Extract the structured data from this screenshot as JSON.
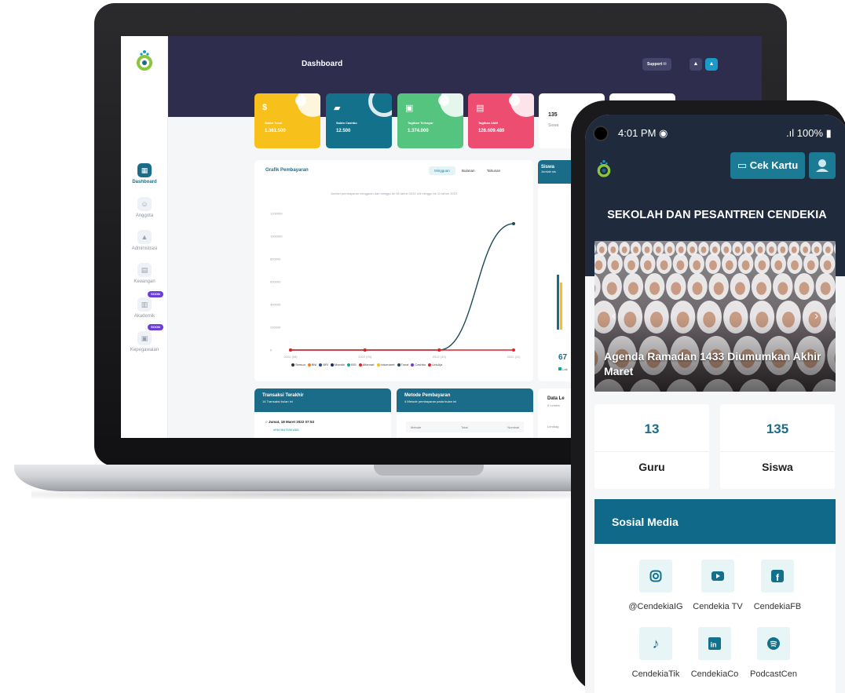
{
  "laptop": {
    "header_title": "Dashboard",
    "support_label": "Support",
    "sidebar": [
      {
        "label": "Dashboard"
      },
      {
        "label": "Anggota"
      },
      {
        "label": "Administrasi"
      },
      {
        "label": "Keuangan"
      },
      {
        "label": "Akademik"
      },
      {
        "label": "Kepegawaian"
      }
    ],
    "soon_label": "SOON",
    "stats": [
      {
        "label": "Saldo Tunai",
        "value": "1.361.500",
        "color": "#f7c01a",
        "icon": "$"
      },
      {
        "label": "Saldo Cashbo",
        "value": "12.500",
        "color": "#14718c",
        "icon": "wallet"
      },
      {
        "label": "Tagihan Terbayar",
        "value": "1.374.000",
        "color": "#55c47e",
        "icon": "folder"
      },
      {
        "label": "Tagihan Aktif",
        "value": "126.609.489",
        "color": "#ee4d72",
        "icon": "doc"
      }
    ],
    "stat_white": {
      "value": "135",
      "label": "Siswa"
    },
    "chart_card": {
      "title": "Grafik Pembayaran",
      "tabs": [
        "Mingguan",
        "Bulanan",
        "Tahunan"
      ],
      "subtitle": "Jumlah pembayaran mingguan dari minggu ke 08 tahun 2022 s/d minggu ke 11 tahun 2022"
    },
    "chart_data": {
      "type": "line",
      "categories": [
        "2022 (08)",
        "2022 (09)",
        "2022 (10)",
        "2022 (11)"
      ],
      "yticks": [
        "0",
        "200000",
        "400000",
        "600000",
        "800000",
        "1000000",
        "1200000"
      ],
      "ylim": [
        0,
        1200000
      ],
      "series": [
        {
          "name": "Tunai",
          "color": "#1c4a56",
          "values": [
            0,
            0,
            0,
            1110000
          ]
        },
        {
          "name": "Alfamart",
          "color": "#e0242a",
          "values": [
            0,
            0,
            0,
            0
          ]
        }
      ],
      "legend": [
        "Semua",
        "BNI",
        "BRI",
        "Mandiri",
        "BSI",
        "Alfamart",
        "Indomaret",
        "Tunai",
        "Cashbo",
        "LinkAja"
      ],
      "legend_colors": [
        "#333333",
        "#f57d20",
        "#274690",
        "#1b2b5a",
        "#14a39a",
        "#e0242a",
        "#f2c418",
        "#1c4a56",
        "#6b3fd6",
        "#e0242a"
      ]
    },
    "side_card": {
      "title": "Siswa",
      "subtitle": "Jumlah sis",
      "value": "67",
      "legend": "Lak"
    },
    "transaksi": {
      "title": "Transaksi Terakhir",
      "subtitle": "14 Transaksi bulan ini",
      "item_date": "Jumat, 18 Maret 2022 07:53",
      "item_code": "#PAYI6475901881"
    },
    "metode": {
      "title": "Metode Pembayaran",
      "subtitle": "4 Metode pembayaran pada bulan ini",
      "cols": [
        "Metode",
        "Total",
        "Nominal"
      ]
    },
    "data_lembaga": {
      "title": "Data Le",
      "subtitle": "0 Lemba",
      "col": "Lembag"
    }
  },
  "phone": {
    "time": "4:01 PM",
    "battery": "100%",
    "signal": ".ıl",
    "cek_kartu": "Cek Kartu",
    "school_name": "SEKOLAH DAN PESANTREN CENDEKIA",
    "news_caption": "Agenda Ramadan 1433 Diumumkan Akhir Maret",
    "stats": [
      {
        "value": "13",
        "label": "Guru"
      },
      {
        "value": "135",
        "label": "Siswa"
      }
    ],
    "social_title": "Sosial Media",
    "social": [
      {
        "icon": "instagram-icon",
        "label": "@CendekiaIG"
      },
      {
        "icon": "youtube-icon",
        "label": "Cendekia TV"
      },
      {
        "icon": "facebook-icon",
        "label": "CendekiaFB"
      },
      {
        "icon": "tiktok-icon",
        "label": "CendekiaTik"
      },
      {
        "icon": "linkedin-icon",
        "label": "CendekiaCo"
      },
      {
        "icon": "spotify-icon",
        "label": "PodcastCen"
      }
    ]
  }
}
